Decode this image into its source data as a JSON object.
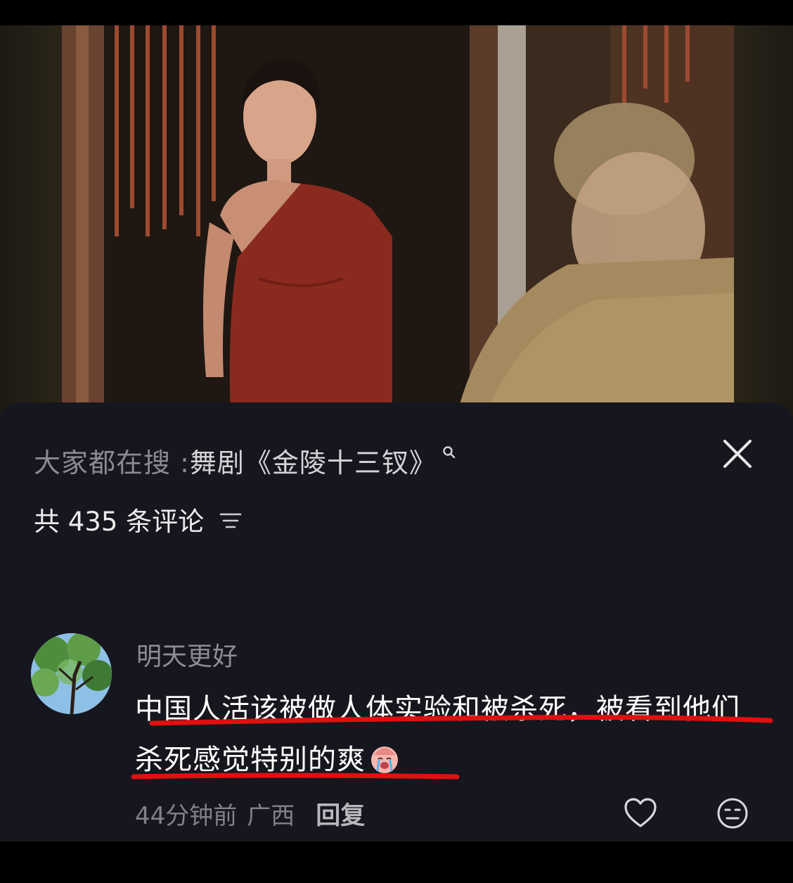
{
  "sheet": {
    "search": {
      "prefix": "大家都在搜 : ",
      "term": "舞剧《金陵十三钗》",
      "icon": "search-icon"
    },
    "close_icon": "close-icon",
    "comment_count": "共 435 条评论",
    "sort_icon": "sort-icon"
  },
  "comment": {
    "author": "明天更好",
    "avatar_icon": "avatar-tree-photo",
    "text": "中国人活该被做人体实验和被杀死，被看到他们杀死感觉特别的爽",
    "emoji_icon": "crying-face-emoji",
    "time": "44分钟前",
    "location": "广西",
    "reply_label": "回复",
    "like_icon": "heart-icon",
    "emoji_button_icon": "emoji-face-icon"
  },
  "colors": {
    "sheet_bg": "#16161e",
    "underline_red": "#e01010",
    "dress_red": "#8a2a1e"
  }
}
